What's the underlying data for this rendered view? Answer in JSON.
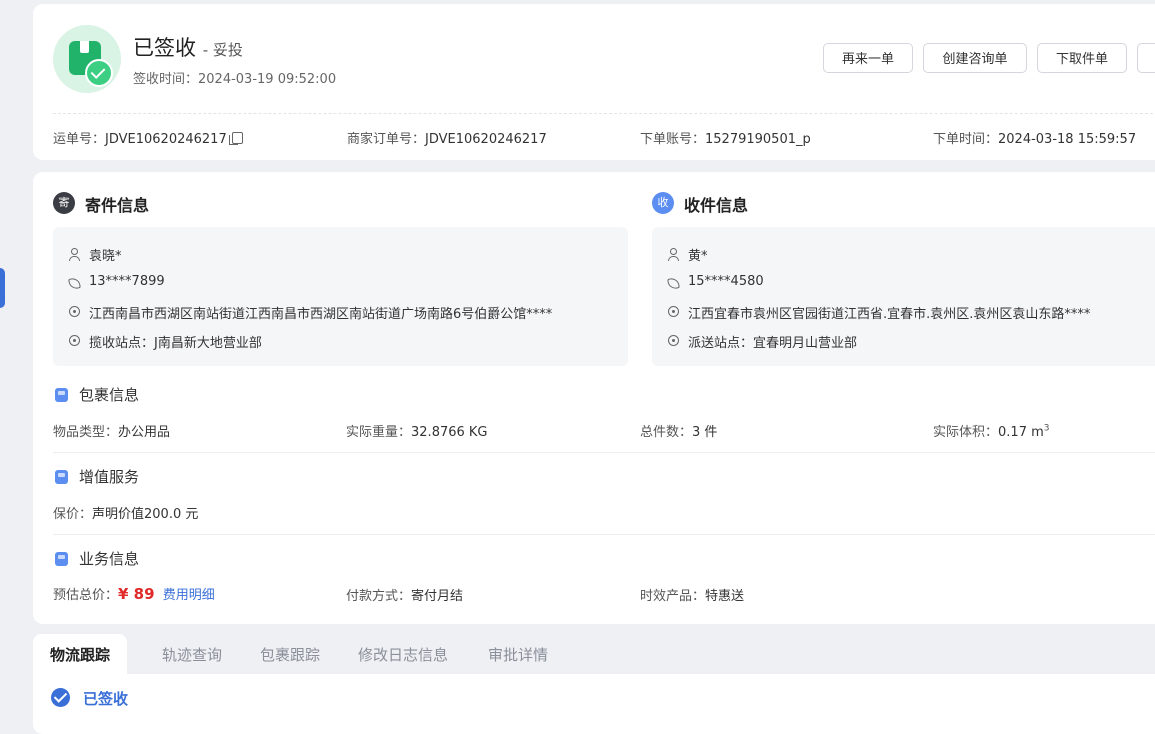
{
  "header": {
    "status": "已签收",
    "status_sub": "- 妥投",
    "sign_time_label": "签收时间：",
    "sign_time": "2024-03-19 09:52:00",
    "buttons": [
      "再来一单",
      "创建咨询单",
      "下取件单"
    ],
    "meta": {
      "waybill_label": "运单号：",
      "waybill": "JDVE10620246217",
      "merchant_label": "商家订单号：",
      "merchant": "JDVE10620246217",
      "account_label": "下单账号：",
      "account": "15279190501_p",
      "order_time_label": "下单时间：",
      "order_time": "2024-03-18 15:59:57"
    }
  },
  "sender": {
    "badge": "寄",
    "title": "寄件信息",
    "name": "袁晓*",
    "phone": "13****7899",
    "address": "江西南昌市西湖区南站街道江西南昌市西湖区南站街道广场南路6号伯爵公馆****",
    "station": "揽收站点：J南昌新大地营业部"
  },
  "receiver": {
    "badge": "收",
    "title": "收件信息",
    "name": "黄*",
    "phone": "15****4580",
    "address": "江西宜春市袁州区官园街道江西省.宜春市.袁州区.袁州区袁山东路****",
    "station": "派送站点：宜春明月山营业部"
  },
  "package": {
    "title": "包裹信息",
    "type_label": "物品类型：",
    "type": "办公用品",
    "weight_label": "实际重量：",
    "weight": "32.8766 KG",
    "count_label": "总件数：",
    "count": "3 件",
    "volume_label": "实际体积：",
    "volume": "0.17 m",
    "volume_exp": "3"
  },
  "value_added": {
    "title": "增值服务",
    "insure_label": "保价：",
    "insure": "声明价值200.0 元"
  },
  "business": {
    "title": "业务信息",
    "price_label": "预估总价：",
    "price": "¥ 89",
    "fee_link": "费用明细",
    "pay_label": "付款方式：",
    "pay": "寄付月结",
    "product_label": "时效产品：",
    "product": "特惠送"
  },
  "tabs": [
    "物流跟踪",
    "轨迹查询",
    "包裹跟踪",
    "修改日志信息",
    "审批详情"
  ],
  "tracking": {
    "status": "已签收"
  },
  "colors": {
    "accent": "#3a6fd8",
    "success": "#22b36a",
    "price": "#e02a2a"
  }
}
